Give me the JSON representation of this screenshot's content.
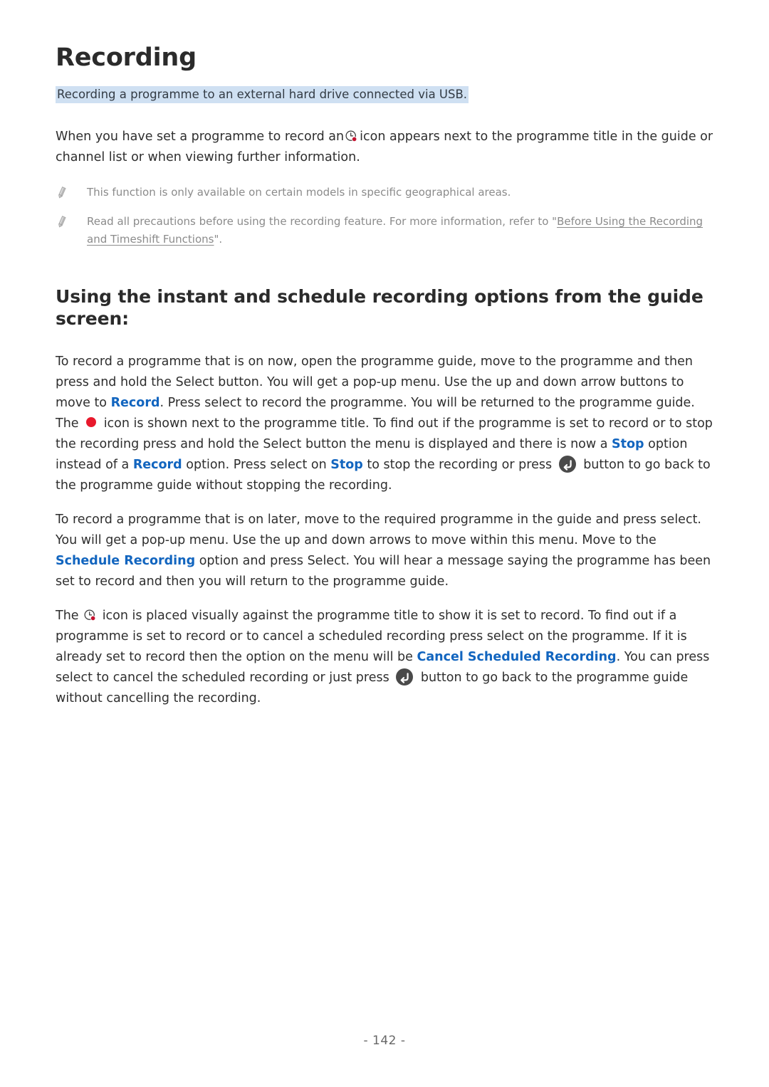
{
  "document": {
    "title": "Recording",
    "subtitle": "Recording a programme to an external hard drive connected via USB.",
    "page_number": "- 142 -",
    "highlight_color": "#cfe0f2",
    "link_color": "#1265bf",
    "record_dot_color": "#e8192c",
    "note_color": "#8b8b8b"
  },
  "intro": {
    "part1": "When you have set a programme to record an",
    "icon": "schedule-recording-clock-icon",
    "part2": "icon appears next to the programme title in the guide or channel list or when viewing further information."
  },
  "notes": [
    {
      "icon": "pencil-note-icon",
      "text": "This function is only available on certain models in specific geographical areas."
    },
    {
      "icon": "pencil-note-icon",
      "text_before": "Read all precautions before using the recording feature. For more information, refer to \"",
      "link": "Before Using the Recording and Timeshift Functions",
      "text_after": "\"."
    }
  ],
  "section": {
    "heading": "Using the instant and schedule recording options from the guide screen:",
    "paragraph1": {
      "s1": "To record a programme that is on now, open the programme guide, move to the programme and then press and hold the Select button. You will get a pop-up menu. Use the up and down arrow buttons to move to ",
      "link1": "Record",
      "s2": ". Press select to record the programme. You will be returned to the programme guide. The ",
      "icon1": "record-dot-icon",
      "s3": " icon is shown next to the programme title. To find out if the programme is set to record or to stop the recording press and hold the Select button the menu is displayed and there is now a ",
      "link2": "Stop",
      "s4": " option instead of a ",
      "link3": "Record",
      "s5": " option. Press select on ",
      "link4": "Stop",
      "s6": " to stop the recording or press ",
      "icon2": "return-button-icon",
      "s7": " button to go back to the programme guide without stopping the recording."
    },
    "paragraph2": {
      "s1": "To record a programme that is on later, move to the required programme in the guide and press select. You will get a pop-up menu. Use the up and down arrows to move within this menu. Move to the ",
      "link1": "Schedule Recording",
      "s2": " option and press Select. You will hear a message saying the programme has been set to record and then you will return to the programme guide."
    },
    "paragraph3": {
      "s1": "The ",
      "icon1": "schedule-recording-clock-icon",
      "s2": " icon is placed visually against the programme title to show it is set to record. To find out if a programme is set to record or to cancel a scheduled recording press select on the programme. If it is already set to record then the option on the menu will be ",
      "link1": "Cancel Scheduled Recording",
      "s3": ". You can press select to cancel the scheduled recording or just press ",
      "icon2": "return-button-icon",
      "s4": " button to go back to the programme guide without cancelling the recording."
    }
  }
}
